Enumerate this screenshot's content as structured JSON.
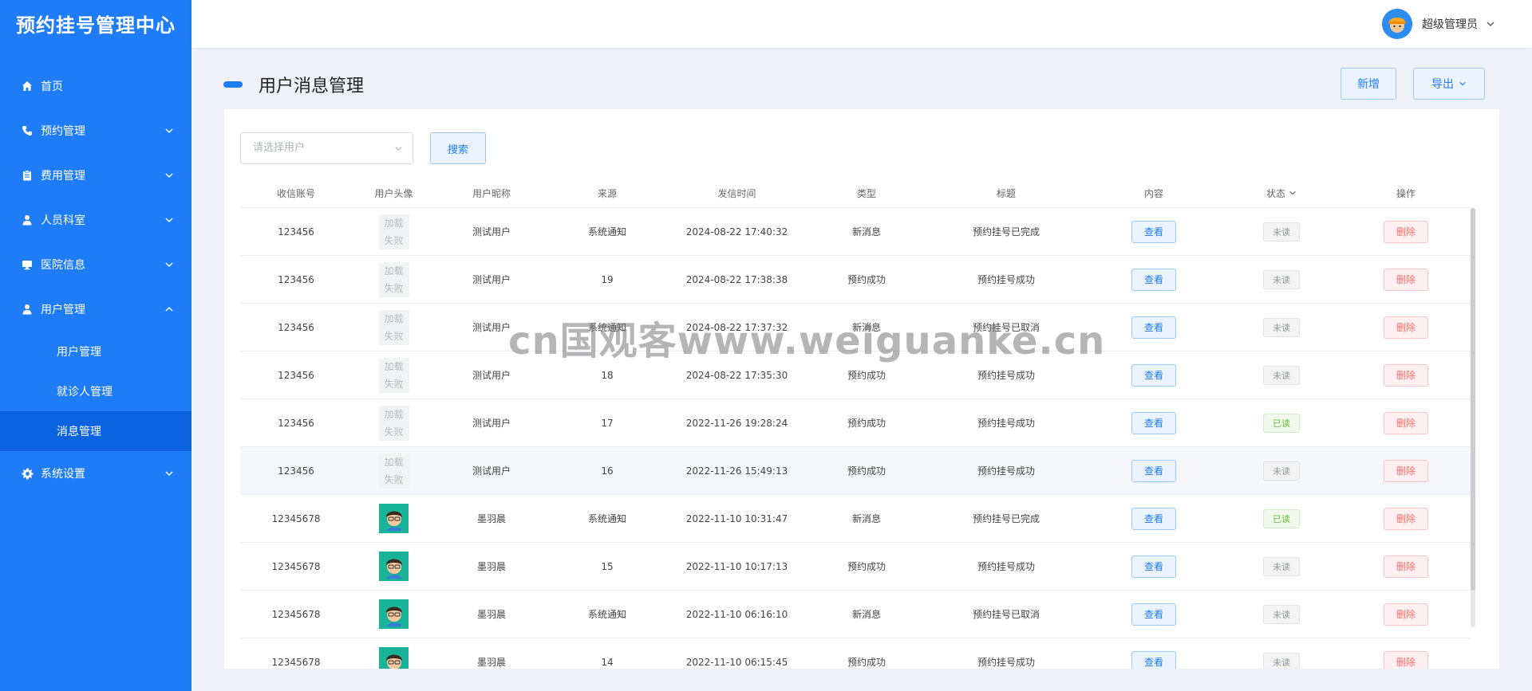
{
  "app": {
    "title": "预约挂号管理中心"
  },
  "sidebar": {
    "items": [
      {
        "label": "首页",
        "icon": "home-icon"
      },
      {
        "label": "预约管理",
        "icon": "phone-icon"
      },
      {
        "label": "费用管理",
        "icon": "clipboard-icon"
      },
      {
        "label": "人员科室",
        "icon": "person-icon"
      },
      {
        "label": "医院信息",
        "icon": "monitor-icon"
      },
      {
        "label": "用户管理",
        "icon": "user-icon",
        "expanded": true,
        "children": [
          {
            "label": "用户管理"
          },
          {
            "label": "就诊人管理"
          },
          {
            "label": "消息管理",
            "active": true
          }
        ]
      },
      {
        "label": "系统设置",
        "icon": "gear-icon"
      }
    ]
  },
  "header": {
    "user_name": "超级管理员"
  },
  "page": {
    "title": "用户消息管理",
    "add_label": "新增",
    "export_label": "导出"
  },
  "filter": {
    "user_placeholder": "请选择用户",
    "search_label": "搜索"
  },
  "table": {
    "columns": [
      "收信账号",
      "用户头像",
      "用户昵称",
      "来源",
      "发信时间",
      "类型",
      "标题",
      "内容",
      "状态",
      "操作"
    ],
    "view_label": "查看",
    "delete_label": "删除",
    "img_fail_text": [
      "加载",
      "失败"
    ],
    "rows": [
      {
        "account": "123456",
        "avatar": "fail",
        "nickname": "测试用户",
        "source": "系统通知",
        "time": "2024-08-22 17:40:32",
        "type": "新消息",
        "title": "预约挂号已完成",
        "status": "未读"
      },
      {
        "account": "123456",
        "avatar": "fail",
        "nickname": "测试用户",
        "source": "19",
        "time": "2024-08-22 17:38:38",
        "type": "预约成功",
        "title": "预约挂号成功",
        "status": "未读"
      },
      {
        "account": "123456",
        "avatar": "fail",
        "nickname": "测试用户",
        "source": "系统通知",
        "time": "2024-08-22 17:37:32",
        "type": "新消息",
        "title": "预约挂号已取消",
        "status": "未读"
      },
      {
        "account": "123456",
        "avatar": "fail",
        "nickname": "测试用户",
        "source": "18",
        "time": "2024-08-22 17:35:30",
        "type": "预约成功",
        "title": "预约挂号成功",
        "status": "未读"
      },
      {
        "account": "123456",
        "avatar": "fail",
        "nickname": "测试用户",
        "source": "17",
        "time": "2022-11-26 19:28:24",
        "type": "预约成功",
        "title": "预约挂号成功",
        "status": "已读"
      },
      {
        "account": "123456",
        "avatar": "fail",
        "nickname": "测试用户",
        "source": "16",
        "time": "2022-11-26 15:49:13",
        "type": "预约成功",
        "title": "预约挂号成功",
        "status": "未读"
      },
      {
        "account": "12345678",
        "avatar": "image",
        "nickname": "墨羽晨",
        "source": "系统通知",
        "time": "2022-11-10 10:31:47",
        "type": "新消息",
        "title": "预约挂号已完成",
        "status": "已读"
      },
      {
        "account": "12345678",
        "avatar": "image",
        "nickname": "墨羽晨",
        "source": "15",
        "time": "2022-11-10 10:17:13",
        "type": "预约成功",
        "title": "预约挂号成功",
        "status": "未读"
      },
      {
        "account": "12345678",
        "avatar": "image",
        "nickname": "墨羽晨",
        "source": "系统通知",
        "time": "2022-11-10 06:16:10",
        "type": "新消息",
        "title": "预约挂号已取消",
        "status": "未读"
      },
      {
        "account": "12345678",
        "avatar": "image",
        "nickname": "墨羽晨",
        "source": "14",
        "time": "2022-11-10 06:15:45",
        "type": "预约成功",
        "title": "预约挂号成功",
        "status": "未读"
      }
    ]
  },
  "watermark": "cn国观客www.weiguanke.cn",
  "colors": {
    "primary": "#1f7cf7",
    "sidebar_active": "#0b63e0",
    "danger": "#f56c6c",
    "success": "#67c23a"
  }
}
